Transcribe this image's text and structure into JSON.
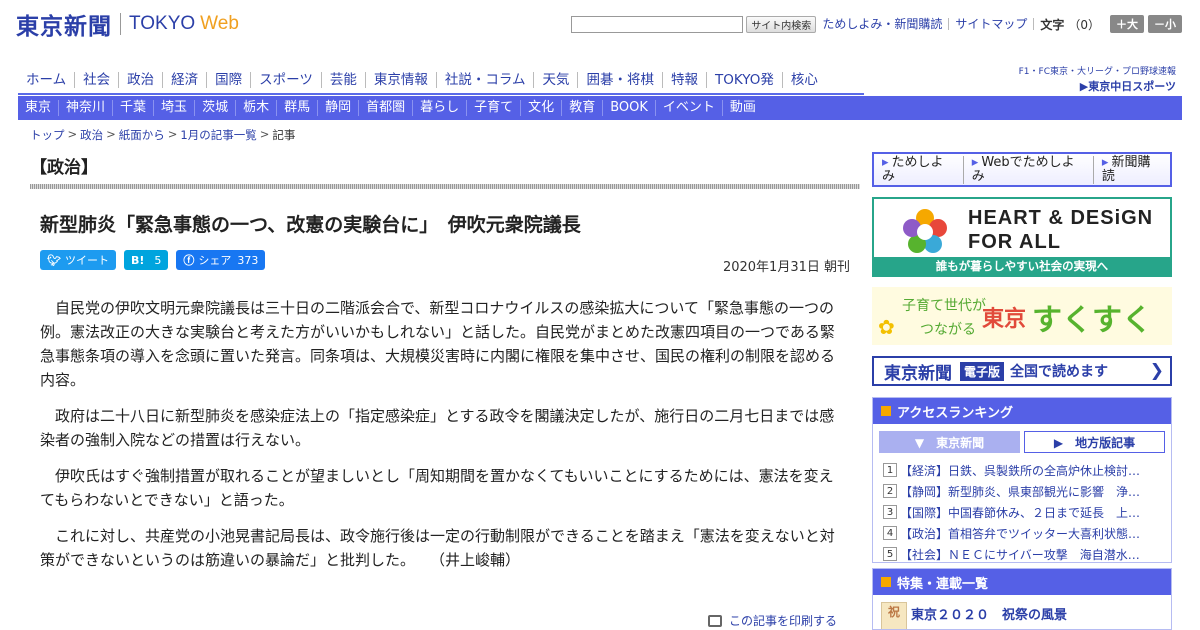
{
  "header": {
    "logo_jp": "東京新聞",
    "logo_en": "TOKYO",
    "logo_web": "Web",
    "search_button": "サイト内検索",
    "links": [
      "ためしよみ・新聞購読",
      "サイトマップ"
    ],
    "font_label": "文字",
    "font_count": "（0）",
    "font_larger": "＋大",
    "font_smaller": "－小"
  },
  "main_nav": [
    "ホーム",
    "社会",
    "政治",
    "経済",
    "国際",
    "スポーツ",
    "芸能",
    "東京情報",
    "社説・コラム",
    "天気",
    "囲碁・将棋",
    "特報",
    "TOKYO発",
    "核心"
  ],
  "chunichi": {
    "top": "F1・FC東京・大リーグ・プロ野球速報",
    "bottom": "▶東京中日スポーツ"
  },
  "regional_nav": [
    "東京",
    "神奈川",
    "千葉",
    "埼玉",
    "茨城",
    "栃木",
    "群馬",
    "静岡",
    "首都圏",
    "暮らし",
    "子育て",
    "文化",
    "教育",
    "BOOK",
    "イベント",
    "動画"
  ],
  "breadcrumb": [
    "トップ",
    "政治",
    "紙面から",
    "1月の記事一覧"
  ],
  "breadcrumb_current": "記事",
  "section_title": "【政治】",
  "article": {
    "headline": "新型肺炎「緊急事態の一つ、改憲の実験台に」　伊吹元衆院議長",
    "date": "2020年1月31日 朝刊",
    "paragraphs": [
      "自民党の伊吹文明元衆院議長は三十日の二階派会合で、新型コロナウイルスの感染拡大について「緊急事態の一つの例。憲法改正の大きな実験台と考えた方がいいかもしれない」と話した。自民党がまとめた改憲四項目の一つである緊急事態条項の導入を念頭に置いた発言。同条項は、大規模災害時に内閣に権限を集中させ、国民の権利の制限を認める内容。",
      "政府は二十八日に新型肺炎を感染症法上の「指定感染症」とする政令を閣議決定したが、施行日の二月七日までは感染者の強制入院などの措置は行えない。",
      "伊吹氏はすぐ強制措置が取れることが望ましいとし「周知期間を置かなくてもいいことにするためには、憲法を変えてもらわないとできない」と語った。",
      "これに対し、共産党の小池晃書記局長は、政令施行後は一定の行動制限ができることを踏まえ「憲法を変えないと対策ができないというのは筋違いの暴論だ」と批判した。　　（井上峻輔）"
    ],
    "print_label": "この記事を印刷する"
  },
  "share": {
    "tweet": "ツイート",
    "hatena_glyph": "B!",
    "hatena_count": "5",
    "facebook_label": "シェア",
    "facebook_count": "373"
  },
  "sidebar": {
    "promo_links": [
      "ためしよみ",
      "Webでためしよみ",
      "新聞購読"
    ],
    "heart_line1": "HEART & DESiGN",
    "heart_line2": "FOR ALL",
    "heart_caption": "誰もが暮らしやすい社会の実現へ",
    "suku_sub1": "子育て世代が",
    "suku_sub2": "つながる",
    "suku_city": "東京",
    "suku_main": "すくすく",
    "digital_jp": "東京新聞",
    "digital_tag": "電子版",
    "digital_read": "全国で読めます",
    "ranking_title": "アクセスランキング",
    "ranking_tab_active": "▼　東京新聞",
    "ranking_tab_other": "▶　地方版記事",
    "ranking_items": [
      "【経済】日鉄、呉製鉄所の全高炉休止検討…",
      "【静岡】新型肺炎、県東部観光に影響　浄…",
      "【国際】中国春節休み、２日まで延長　上…",
      "【政治】首相答弁でツイッター大喜利状態…",
      "【社会】ＮＥＣにサイバー攻撃　海自潜水…"
    ],
    "feature_title": "特集・連載一覧",
    "feature_item": "東京２０２０　祝祭の風景",
    "feature_thumb": "祝"
  },
  "colors": {
    "brand_blue": "#2b3fa8",
    "nav_blue": "#5560e6",
    "accent_orange": "#f6a800",
    "teal": "#27a58a"
  }
}
